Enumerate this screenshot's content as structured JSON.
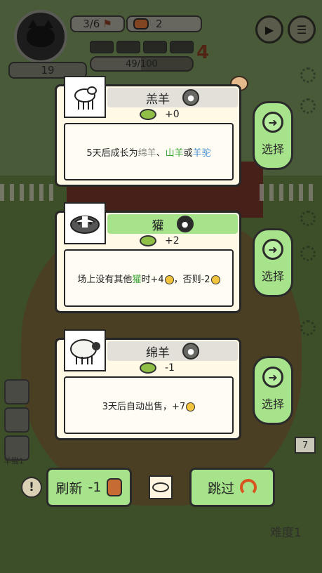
{
  "hud": {
    "day_progress": "3/6",
    "food_count": "2",
    "coins": "19",
    "exp_text": "49/100",
    "exp_fraction": 0.49,
    "level": "4"
  },
  "cards": [
    {
      "name": "羔羊",
      "food_delta": "+0",
      "desc_parts": [
        "5天后成长为",
        "绵羊",
        "、",
        "山羊",
        "或",
        "羊驼"
      ],
      "icon": "sheep-lamb-icon",
      "head_color": "#e2e0d8"
    },
    {
      "name": "獾",
      "food_delta": "+2",
      "desc_parts": [
        "场上没有其他",
        "獾",
        "时+4",
        "，否则-2"
      ],
      "icon": "badger-icon",
      "head_color": "#a6e38a"
    },
    {
      "name": "绵羊",
      "food_delta": "-1",
      "desc_parts": [
        "3天后自动出售，+7"
      ],
      "icon": "sheep-icon",
      "head_color": "#e2e0d8"
    }
  ],
  "select_label": "选择",
  "refresh": {
    "label": "刷新",
    "cost": "-1"
  },
  "skip_label": "跳过",
  "difficulty": "难度1",
  "side_label": "羊猫1",
  "right_tile": "7",
  "colors": {
    "accent_green": "#a6e38a",
    "highlight_green": "#3fa73a",
    "highlight_blue": "#4a90d9"
  }
}
